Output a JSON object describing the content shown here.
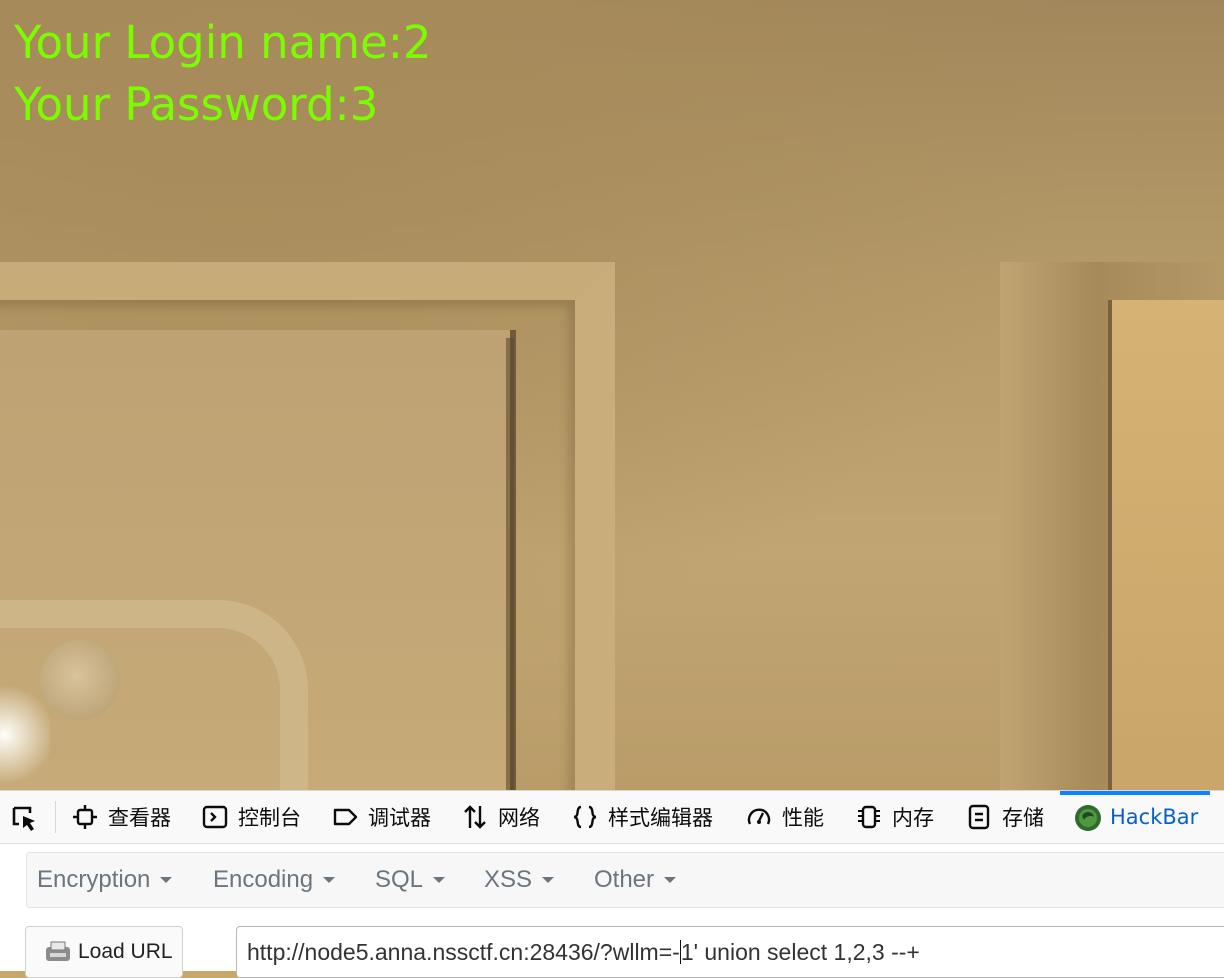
{
  "page": {
    "login_line": "Your Login name:2",
    "password_line": "Your Password:3",
    "text_color": "#7cfc00"
  },
  "devtools": {
    "tabs": [
      {
        "label": "查看器",
        "icon": "inspector-icon"
      },
      {
        "label": "控制台",
        "icon": "console-icon"
      },
      {
        "label": "调试器",
        "icon": "debugger-icon"
      },
      {
        "label": "网络",
        "icon": "network-icon"
      },
      {
        "label": "样式编辑器",
        "icon": "style-editor-icon"
      },
      {
        "label": "性能",
        "icon": "performance-icon"
      },
      {
        "label": "内存",
        "icon": "memory-icon"
      },
      {
        "label": "存储",
        "icon": "storage-icon"
      },
      {
        "label": "HackBar",
        "icon": "hackbar-icon",
        "active": true
      }
    ],
    "active_color": "#0a84ff"
  },
  "hackbar": {
    "menus": [
      "Encryption",
      "Encoding",
      "SQL",
      "XSS",
      "Other"
    ],
    "load_url_label": "Load URL",
    "url_before_cursor": "http://node5.anna.nssctf.cn:28436/?wllm=-",
    "url_after_cursor": "1' union select 1,2,3 --+"
  }
}
